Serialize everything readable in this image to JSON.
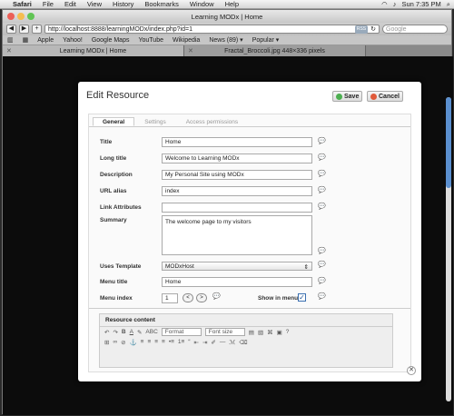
{
  "menubar": {
    "items": [
      "Safari",
      "File",
      "Edit",
      "View",
      "History",
      "Bookmarks",
      "Window",
      "Help"
    ],
    "time": "Sun 7:35 PM"
  },
  "window": {
    "title": "Learning MODx | Home",
    "url": "http://localhost:8888/learningMODx/index.php?id=1",
    "rss": "RSS",
    "search_placeholder": "Google"
  },
  "bookmarks": [
    "Apple",
    "Yahoo!",
    "Google Maps",
    "YouTube",
    "Wikipedia",
    "News (89) ▾",
    "Popular ▾"
  ],
  "tabs": [
    "Learning MODx | Home",
    "Fractal_Broccoli.jpg 448×336 pixels"
  ],
  "modal": {
    "title": "Edit Resource",
    "save": "Save",
    "cancel": "Cancel",
    "tabs": [
      "General",
      "Settings",
      "Access permissions"
    ],
    "fields": {
      "title_label": "Title",
      "title_value": "Home",
      "longtitle_label": "Long title",
      "longtitle_value": "Welcome to Learning MODx",
      "description_label": "Description",
      "description_value": "My Personal Site using MODx",
      "alias_label": "URL alias",
      "alias_value": "index",
      "link_label": "Link Attributes",
      "link_value": "",
      "summary_label": "Summary",
      "summary_value": "The welcome page to my visitors",
      "template_label": "Uses Template",
      "template_value": "MODxHost",
      "menutitle_label": "Menu title",
      "menutitle_value": "Home",
      "menuindex_label": "Menu index",
      "menuindex_value": "1",
      "showmenu_label": "Show in menu"
    },
    "rte": {
      "heading": "Resource content",
      "format": "Format",
      "fontsize": "Font size"
    }
  },
  "colors": {
    "accent": "#5b8fcf",
    "save": "#4caf50",
    "cancel": "#e05a3a"
  }
}
